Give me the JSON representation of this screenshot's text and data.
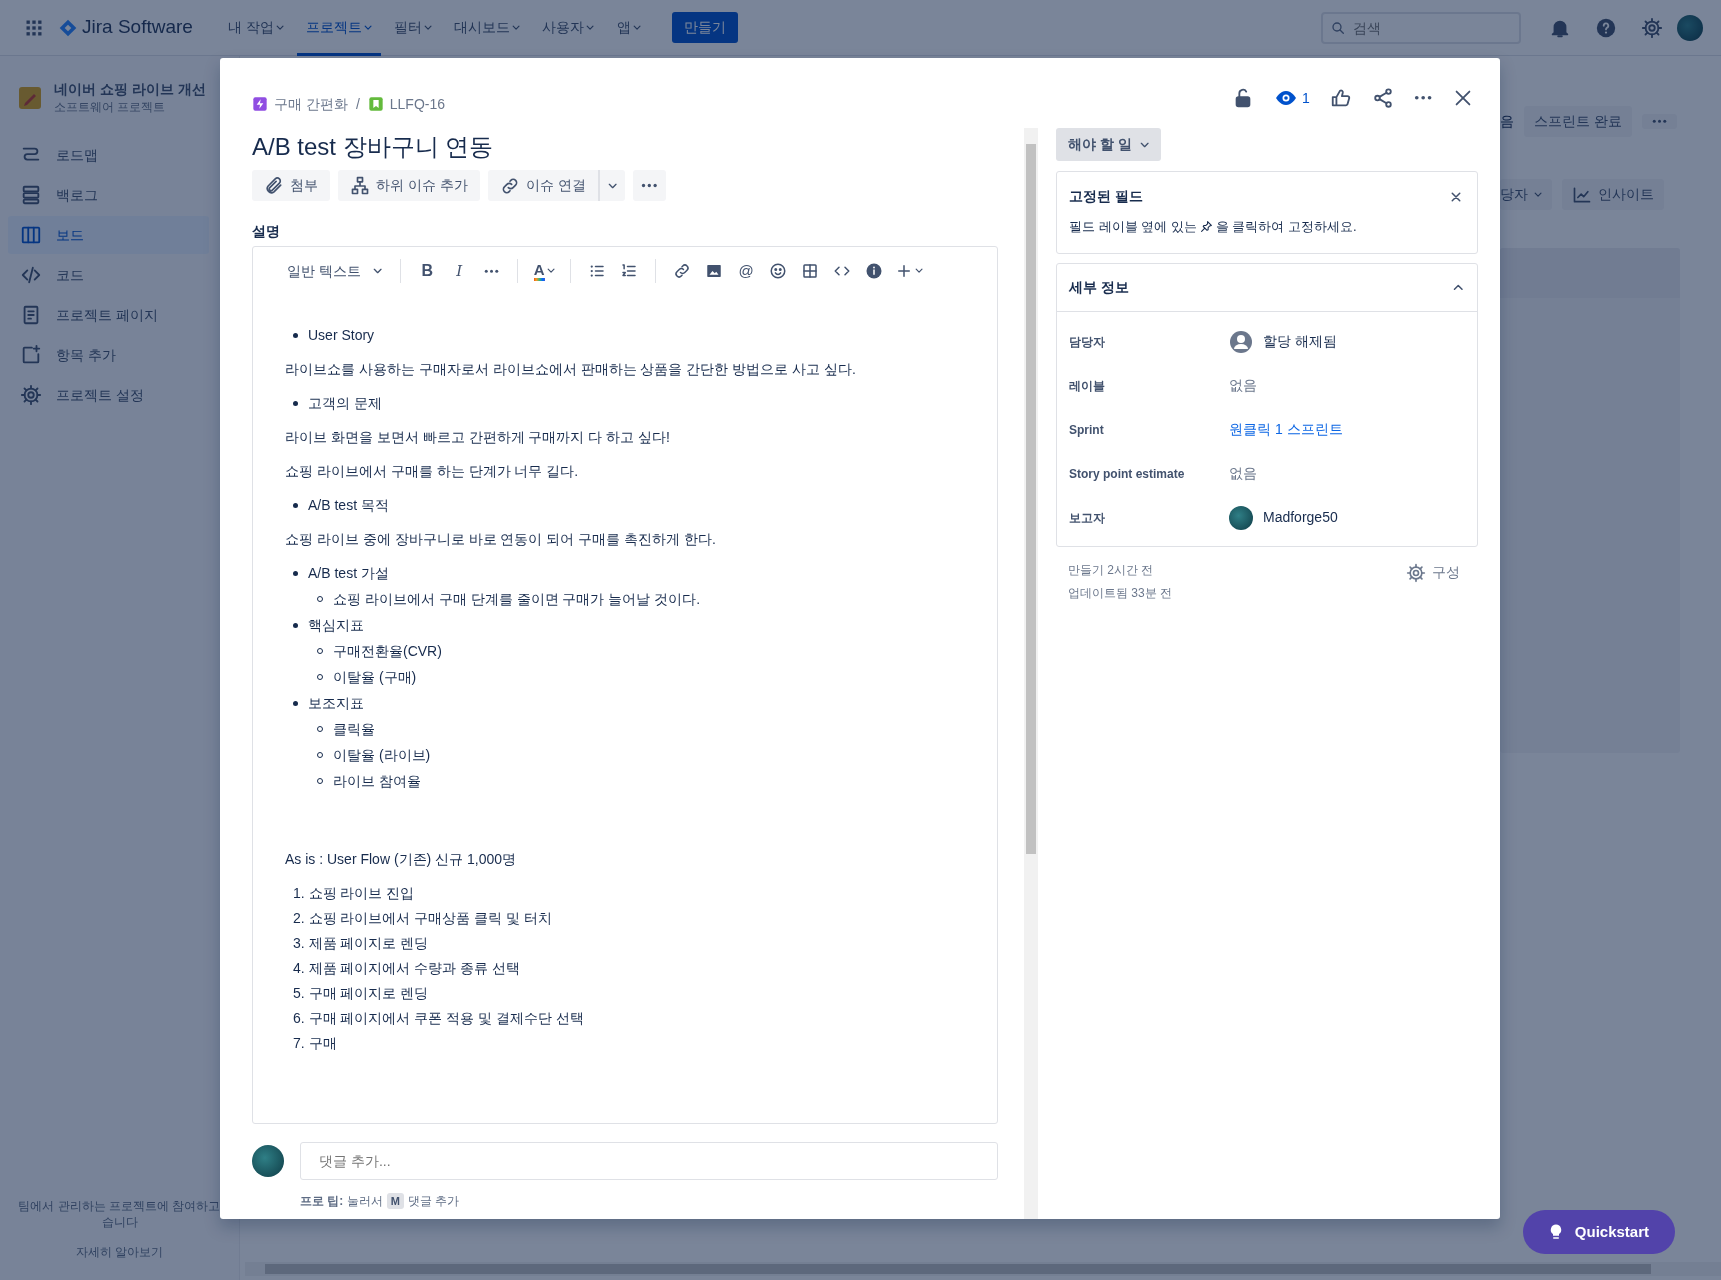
{
  "topbar": {
    "app_name": "Jira Software",
    "nav": [
      {
        "label": "내 작업",
        "selected": false
      },
      {
        "label": "프로젝트",
        "selected": true
      },
      {
        "label": "필터",
        "selected": false
      },
      {
        "label": "대시보드",
        "selected": false
      },
      {
        "label": "사용자",
        "selected": false
      },
      {
        "label": "앱",
        "selected": false
      }
    ],
    "create_button": "만들기",
    "search": {
      "placeholder": "검색"
    }
  },
  "sidebar": {
    "project_name": "네이버 쇼핑 라이브 개선",
    "project_type": "소프트웨어 프로젝트",
    "items": [
      {
        "kind": "roadmap",
        "label": "로드맵",
        "selected": false
      },
      {
        "kind": "backlog",
        "label": "백로그",
        "selected": false
      },
      {
        "kind": "board",
        "label": "보드",
        "selected": true
      },
      {
        "kind": "code",
        "label": "코드",
        "selected": false
      },
      {
        "kind": "page",
        "label": "프로젝트 페이지",
        "selected": false
      },
      {
        "kind": "add",
        "label": "항목 추가",
        "selected": false
      },
      {
        "kind": "settings",
        "label": "프로젝트 설정",
        "selected": false
      }
    ],
    "footer_lines": [
      "팀에서 관리하는 프로젝트에 참여하고",
      "습니다"
    ],
    "footer_link": "자세히 알아보기"
  },
  "board": {
    "partial_text": "음",
    "complete_sprint_button": "스프린트 완료",
    "filter_button": "당자",
    "insights_button": "인사이트"
  },
  "issue": {
    "breadcrumb_separator": "/",
    "breadcrumb": [
      {
        "kind": "epic",
        "label": "구매 간편화"
      },
      {
        "kind": "story",
        "label": "LLFQ-16"
      }
    ],
    "watchers": "1",
    "title": "A/B test 장바구니 연동",
    "actions": [
      {
        "kind": "attach",
        "label": "첨부"
      },
      {
        "kind": "child",
        "label": "하위 이슈 추가"
      },
      {
        "kind": "link",
        "label": "이슈 연결"
      }
    ],
    "description_label": "설명",
    "editor_tools": [
      {
        "kind": "style",
        "label": "일반 텍스트"
      },
      {
        "kind": "sep"
      },
      {
        "kind": "bold",
        "glyph": "B"
      },
      {
        "kind": "italic",
        "glyph": "I"
      },
      {
        "kind": "more"
      },
      {
        "kind": "sep"
      },
      {
        "kind": "color",
        "glyph": "A"
      },
      {
        "kind": "sep"
      },
      {
        "kind": "ul"
      },
      {
        "kind": "ol"
      },
      {
        "kind": "sep"
      },
      {
        "kind": "link"
      },
      {
        "kind": "image"
      },
      {
        "kind": "mention",
        "glyph": "@"
      },
      {
        "kind": "emoji"
      },
      {
        "kind": "table"
      },
      {
        "kind": "code"
      },
      {
        "kind": "info"
      },
      {
        "kind": "insert"
      }
    ],
    "content": [
      {
        "kind": "bullet",
        "items": [
          {
            "text": "User Story"
          }
        ]
      },
      {
        "kind": "para",
        "text": "라이브쇼를 사용하는 구매자로서 라이브쇼에서 판매하는 상품을 간단한 방법으로 사고 싶다."
      },
      {
        "kind": "bullet",
        "items": [
          {
            "text": "고객의 문제"
          }
        ]
      },
      {
        "kind": "para",
        "text": "라이브 화면을 보면서 빠르고 간편하게 구매까지 다 하고 싶다!"
      },
      {
        "kind": "para",
        "text": "쇼핑 라이브에서 구매를 하는 단계가 너무 길다."
      },
      {
        "kind": "bullet",
        "items": [
          {
            "text": "A/B test 목적"
          }
        ]
      },
      {
        "kind": "para",
        "text": "쇼핑 라이브 중에 장바구니로 바로 연동이 되어 구매를 촉진하게 한다."
      },
      {
        "kind": "bullet",
        "items": [
          {
            "text": "A/B test 가설",
            "children": [
              "쇼핑 라이브에서 구매 단계를 줄이면 구매가 늘어날 것이다."
            ]
          },
          {
            "text": "핵심지표",
            "children": [
              "구매전환율(CVR)",
              "이탈율 (구매)"
            ]
          },
          {
            "text": "보조지표",
            "children": [
              "클릭율",
              "이탈율 (라이브)",
              "라이브 참여율"
            ]
          }
        ]
      },
      {
        "kind": "blank"
      },
      {
        "kind": "para",
        "text": "As is : User Flow (기존) 신규 1,000명"
      },
      {
        "kind": "ordered",
        "items": [
          "1. 쇼핑 라이브 진입",
          "2. 쇼핑 라이브에서 구매상품 클릭 및 터치",
          "3. 제품 페이지로 렌딩",
          "4. 제품 페이지에서 수량과 종류 선택",
          "5. 구매 페이지로 렌딩",
          "6. 구매 페이지에서 쿠폰 적용 및 결제수단 선택",
          "7. 구매"
        ]
      }
    ],
    "comment": {
      "placeholder": "댓글 추가...",
      "tip": "**프로 팁:** 눌러서",
      "key": "M",
      "tip_end": "댓글 추가"
    },
    "status": "해야 할 일",
    "pinned": {
      "title": "고정된 필드",
      "hint_before": "필드 레이블 옆에 있는",
      "hint_after": "을 클릭하여 고정하세요."
    },
    "details": {
      "title": "세부 정보",
      "expanded": true,
      "fields": [
        {
          "kind": "unassigned",
          "label": "담당자",
          "value": "할당 해제됨"
        },
        {
          "kind": "empty",
          "label": "레이블",
          "value": "없음"
        },
        {
          "kind": "link",
          "label": "Sprint",
          "value": "원클릭 1 스프린트"
        },
        {
          "kind": "empty",
          "label": "Story point estimate",
          "value": "없음"
        },
        {
          "kind": "user",
          "label": "보고자",
          "value": "Madforge50"
        }
      ]
    },
    "created": "만들기 2시간 전",
    "updated": "업데이트됨 33분 전",
    "configure": "구성"
  },
  "quickstart": "Quickstart"
}
